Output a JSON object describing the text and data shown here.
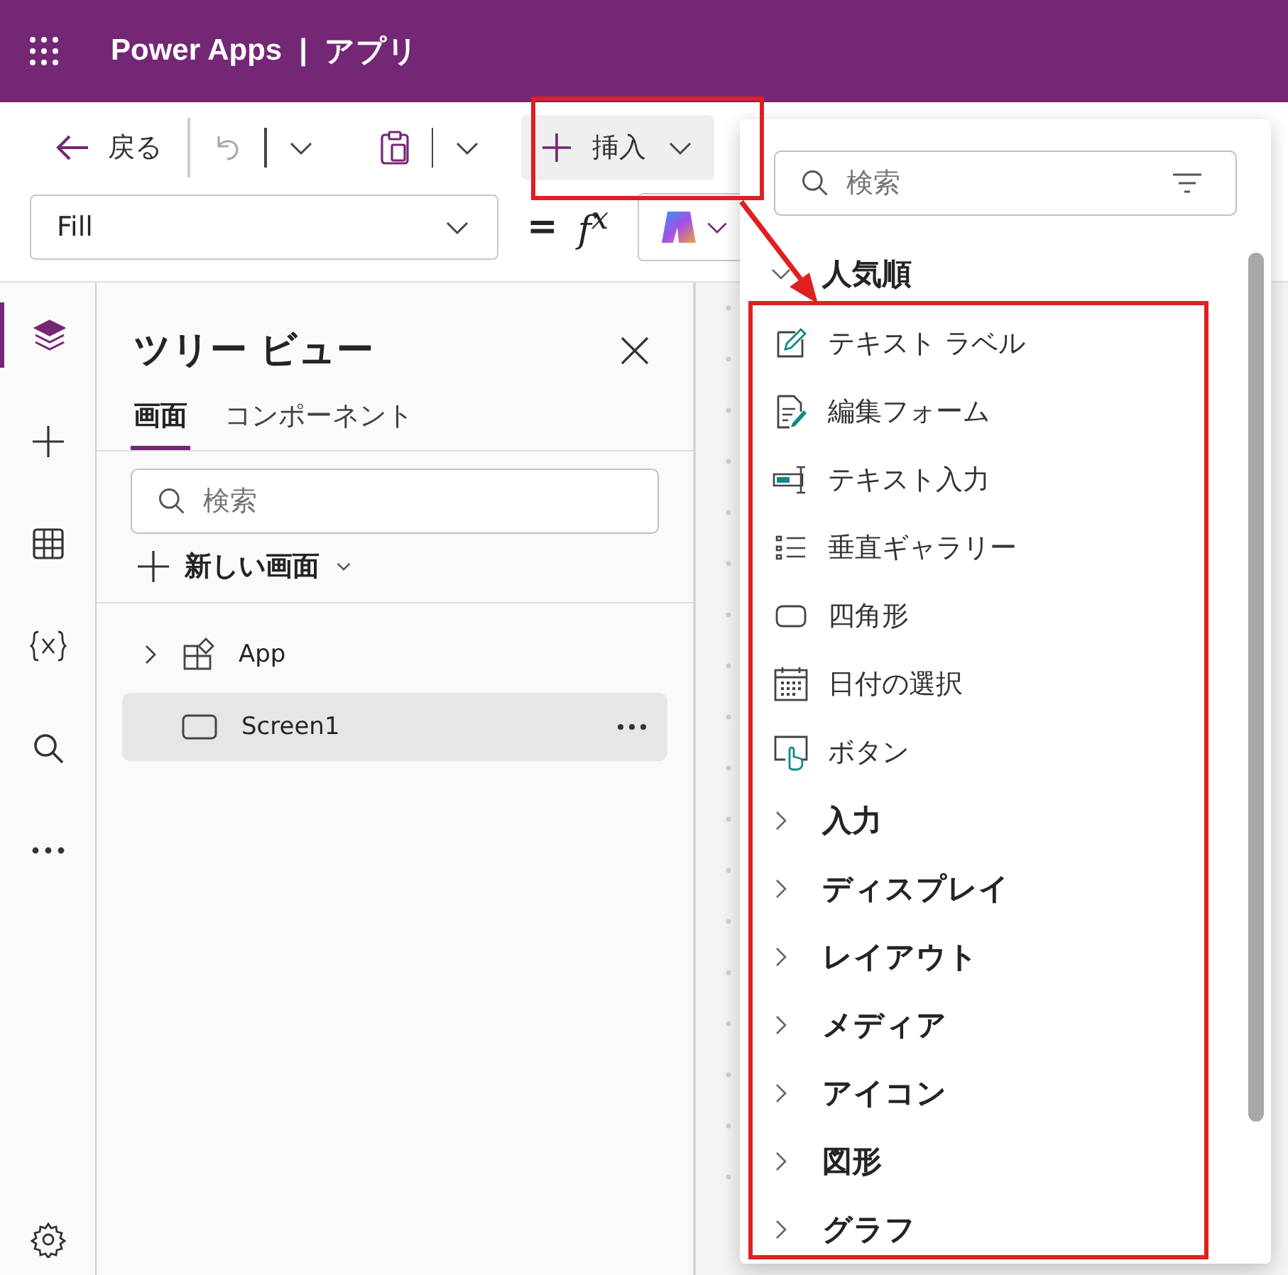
{
  "app_bar": {
    "title": "Power Apps",
    "separator": "|",
    "app_name": "アプリ"
  },
  "toolbar": {
    "back": "戻る",
    "insert": "挿入"
  },
  "formula_bar": {
    "property": "Fill",
    "equals": "=",
    "fx": "f$^{x}$"
  },
  "rail": [
    {
      "kind": "layers",
      "selected": true
    },
    {
      "kind": "plus",
      "selected": false
    },
    {
      "kind": "table",
      "selected": false
    },
    {
      "kind": "variables",
      "selected": false
    },
    {
      "kind": "search",
      "selected": false
    },
    {
      "kind": "more",
      "selected": false
    }
  ],
  "tree_view": {
    "title": "ツリー ビュー",
    "tabs": [
      {
        "label": "画面",
        "selected": true
      },
      {
        "label": "コンポーネント",
        "selected": false
      }
    ],
    "search": {
      "placeholder": "検索"
    },
    "new_screen": "新しい画面",
    "nodes": [
      {
        "label": "App",
        "kind": "app",
        "expanded": false,
        "selected": false
      },
      {
        "label": "Screen1",
        "kind": "screen",
        "selected": true
      }
    ]
  },
  "insert_panel": {
    "search": {
      "placeholder": "検索"
    },
    "popular": {
      "label": "人気順",
      "expanded": true,
      "items": [
        {
          "label": "テキスト ラベル",
          "kind": "label"
        },
        {
          "label": "編集フォーム",
          "kind": "form"
        },
        {
          "label": "テキスト入力",
          "kind": "input"
        },
        {
          "label": "垂直ギャラリー",
          "kind": "gallery"
        },
        {
          "label": "四角形",
          "kind": "rectangle"
        },
        {
          "label": "日付の選択",
          "kind": "date"
        },
        {
          "label": "ボタン",
          "kind": "button"
        }
      ]
    },
    "categories": [
      {
        "label": "入力",
        "expanded": false
      },
      {
        "label": "ディスプレイ",
        "expanded": false
      },
      {
        "label": "レイアウト",
        "expanded": false
      },
      {
        "label": "メディア",
        "expanded": false
      },
      {
        "label": "アイコン",
        "expanded": false
      },
      {
        "label": "図形",
        "expanded": false
      },
      {
        "label": "グラフ",
        "expanded": false
      }
    ]
  }
}
